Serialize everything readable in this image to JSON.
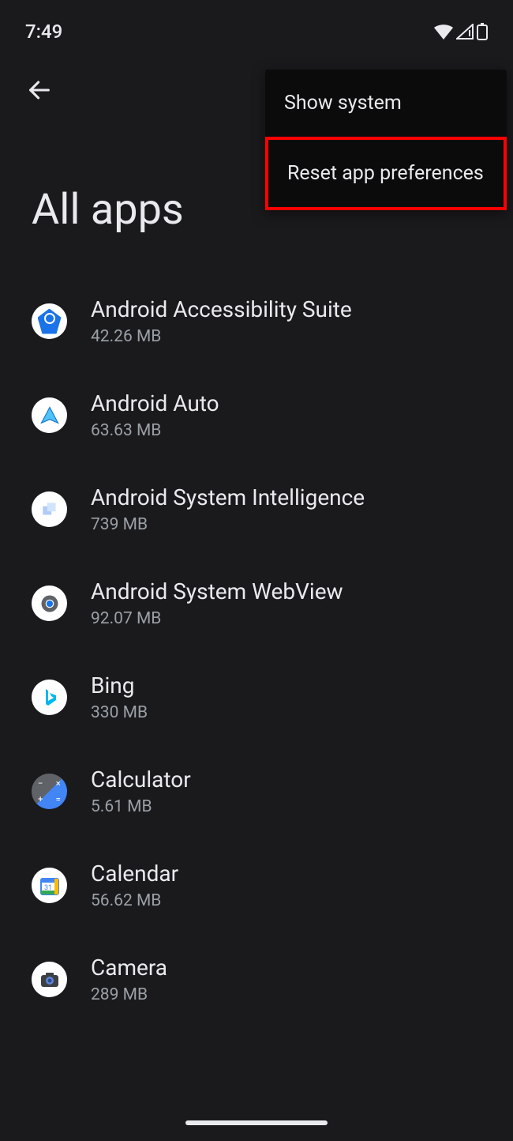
{
  "status": {
    "time": "7:49"
  },
  "page": {
    "title": "All apps"
  },
  "menu": {
    "items": [
      {
        "label": "Show system"
      },
      {
        "label": "Reset app preferences"
      }
    ]
  },
  "apps": [
    {
      "name": "Android Accessibility Suite",
      "size": "42.26 MB",
      "icon": "accessibility-icon"
    },
    {
      "name": "Android Auto",
      "size": "63.63 MB",
      "icon": "android-auto-icon"
    },
    {
      "name": "Android System Intelligence",
      "size": "739 MB",
      "icon": "system-intelligence-icon"
    },
    {
      "name": "Android System WebView",
      "size": "92.07 MB",
      "icon": "webview-icon"
    },
    {
      "name": "Bing",
      "size": "330 MB",
      "icon": "bing-icon"
    },
    {
      "name": "Calculator",
      "size": "5.61 MB",
      "icon": "calculator-icon"
    },
    {
      "name": "Calendar",
      "size": "56.62 MB",
      "icon": "calendar-icon"
    },
    {
      "name": "Camera",
      "size": "289 MB",
      "icon": "camera-icon"
    }
  ]
}
